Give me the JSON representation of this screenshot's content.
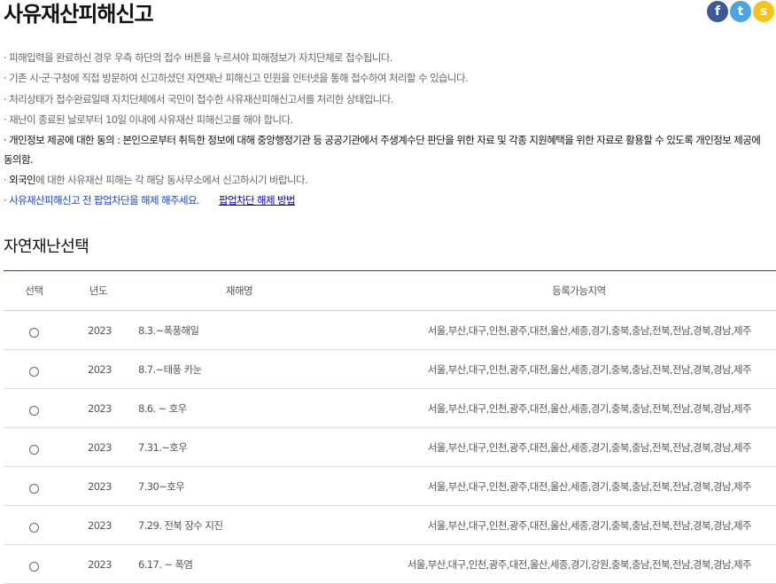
{
  "header": {
    "title": "사유재산피해신고",
    "social": [
      {
        "icon": "facebook-icon",
        "glyph": "f",
        "color": "#3b5998"
      },
      {
        "icon": "twitter-icon",
        "glyph": "t",
        "color": "#4aa4e3"
      },
      {
        "icon": "kakaostory-icon",
        "glyph": "s",
        "color": "#f6c31b"
      }
    ]
  },
  "notices": [
    "· 피해입력을 완료하신 경우 우측 하단의 접수 버튼을 누르셔야 피해정보가 자치단체로 접수됩니다.",
    "· 기존 시·군·구청에 직접 방문하여 신고하셨던 자연재난 피해신고 민원을 인터넷을 통해 접수하여 처리할 수 있습니다.",
    "· 처리상태가 접수완료일때 자치단체에서 국민이 접수한 사유재산피해신고서를 처리한 상태입니다.",
    "· 재난이 종료된 날로부터 10일 이내에 사유재산 피해신고를 해야 합니다.",
    "· 개인정보 제공에 대한 동의 : 본인으로부터 취득한 정보에 대해 중앙행정기관 등 공공기관에서 주생계수단 판단을 위한 자료 및 각종 지원혜택을 위한 자료로 활용할 수 있도록 개인정보 제공에 동의함."
  ],
  "foreigner_notice": {
    "prefix": "· ",
    "highlight": "외국인",
    "rest": "에 대한 사유재산 피해는 각 해당 동사무소에서 신고하시기 바랍니다."
  },
  "popup_notice": {
    "text": "· 사유재산피해신고 전 팝업차단을 해제 해주세요.",
    "link": "팝업차단 해제 방법"
  },
  "section_title": "자연재난선택",
  "table": {
    "headers": [
      "선택",
      "년도",
      "재해명",
      "등록가능지역"
    ],
    "rows": [
      {
        "year": "2023",
        "name": "8.3.~폭풍해일",
        "regions": "서울,부산,대구,인천,광주,대전,울산,세종,경기,충북,충남,전북,전남,경북,경남,제주"
      },
      {
        "year": "2023",
        "name": "8.7.~태풍 카눈",
        "regions": "서울,부산,대구,인천,광주,대전,울산,세종,경기,충북,충남,전북,전남,경북,경남,제주"
      },
      {
        "year": "2023",
        "name": "8.6. ~ 호우",
        "regions": "서울,부산,대구,인천,광주,대전,울산,세종,경기,충북,충남,전북,전남,경북,경남,제주"
      },
      {
        "year": "2023",
        "name": "7.31.~호우",
        "regions": "서울,부산,대구,인천,광주,대전,울산,세종,경기,충북,충남,전북,전남,경북,경남,제주"
      },
      {
        "year": "2023",
        "name": "7.30~호우",
        "regions": "서울,부산,대구,인천,광주,대전,울산,세종,경기,충북,충남,전북,전남,경북,경남,제주"
      },
      {
        "year": "2023",
        "name": "7.29. 전북 장수 지진",
        "regions": "서울,부산,대구,인천,광주,대전,울산,세종,경기,충북,충남,전북,전남,경북,경남,제주"
      },
      {
        "year": "2023",
        "name": "6.17. ~ 폭염",
        "regions": "서울,부산,대구,인천,광주,대전,울산,세종,경기,강원,충북,충남,전북,전남,경북,경남,제주"
      }
    ]
  }
}
